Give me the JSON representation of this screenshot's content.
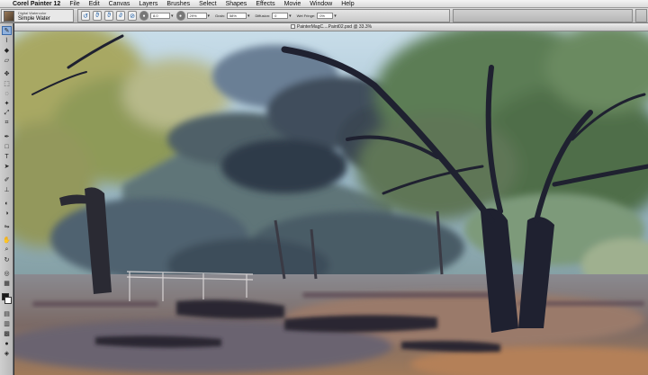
{
  "menubar": {
    "apple_glyph": "",
    "app_name": "Corel Painter 12",
    "items": [
      "File",
      "Edit",
      "Canvas",
      "Layers",
      "Brushes",
      "Select",
      "Shapes",
      "Effects",
      "Movie",
      "Window",
      "Help"
    ]
  },
  "brush_selector": {
    "category": "Digital Watercolor",
    "variant": "Simple Water"
  },
  "property_bar": {
    "size_value": "8.0",
    "opacity_value": "29%",
    "grain_label": "Grain:",
    "grain_value": "58%",
    "diffusion_label": "Diffusion:",
    "diffusion_value": "0",
    "wet_fringe_label": "Wet Fringe:",
    "wet_fringe_value": "0%"
  },
  "document": {
    "title": "PainterMagC....Paint02.psd @ 33.3%"
  },
  "colors": {
    "main_color": "#1a1a1a",
    "additional_color": "#ffffff",
    "accent": "#3c6aa8"
  },
  "toolbox_icons": [
    "brush-icon",
    "dropper-icon",
    "paint-bucket-icon",
    "eraser-icon",
    "layer-adjuster-icon",
    "rectangular-selection-icon",
    "lasso-icon",
    "magic-wand-icon",
    "transform-icon",
    "crop-icon",
    "pen-icon",
    "rectangle-shape-icon",
    "text-icon",
    "shape-selection-icon",
    "cloner-icon",
    "rubber-stamp-icon",
    "dodge-icon",
    "burn-icon",
    "mirror-icon",
    "grabber-icon",
    "magnifier-icon",
    "rotate-page-icon",
    "divine-proportion-icon",
    "layout-grid-icon"
  ]
}
